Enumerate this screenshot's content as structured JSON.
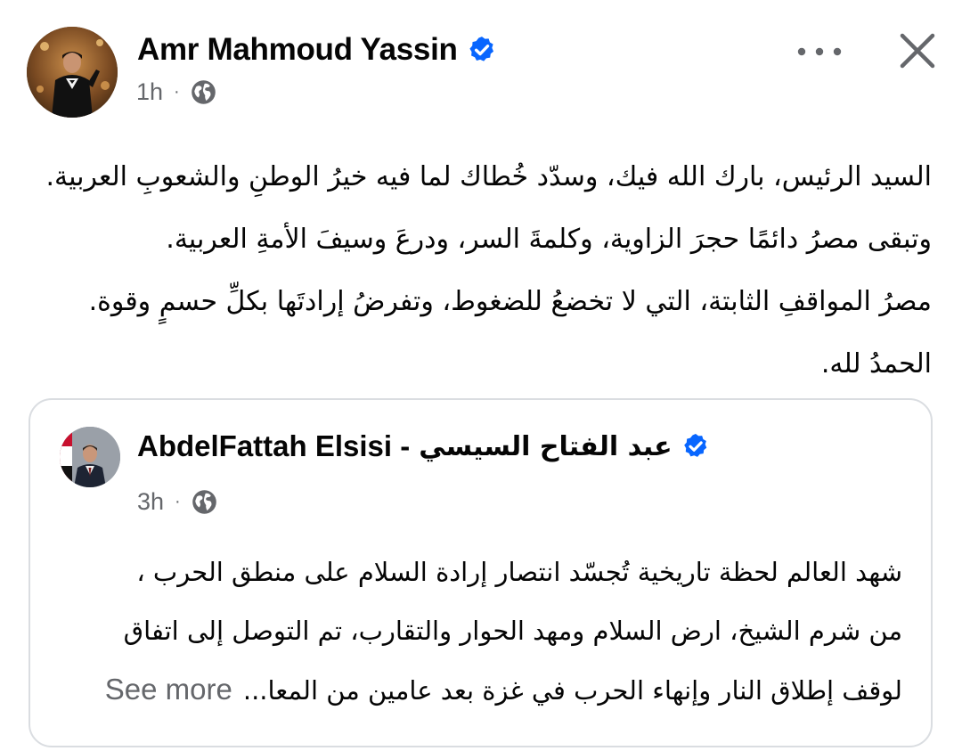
{
  "post": {
    "author": "Amr Mahmoud Yassin",
    "time": "1h",
    "dot": "·",
    "privacy_icon": "globe-icon",
    "verified_icon": "verified-badge-icon",
    "text_lines": [
      "السيد الرئيس، بارك الله فيك، وسدّد خُطاك لما فيه خيرُ الوطنِ والشعوبِ العربية.",
      "وتبقى مصرُ دائمًا حجرَ الزاوية، وكلمةَ السر، ودرعَ وسيفَ الأمةِ العربية.",
      "مصرُ المواقفِ الثابتة، التي لا تخضعُ للضغوط، وتفرضُ إرادتَها بكلِّ حسمٍ وقوة.",
      "الحمدُ لله."
    ]
  },
  "shared_post": {
    "author_en": "AbdelFattah Elsisi -",
    "author_ar": "عبد الفتاح السيسي",
    "time": "3h",
    "dot": "·",
    "privacy_icon": "globe-icon",
    "text_lines": [
      "شهد العالم لحظة تاريخية تُجسّد انتصار إرادة السلام على منطق الحرب ،",
      "من شرم الشيخ، ارض السلام ومهد الحوار والتقارب، تم التوصل إلى اتفاق",
      "لوقف إطلاق النار وإنهاء الحرب في غزة بعد عامين من المعا..."
    ],
    "see_more": "See more"
  },
  "colors": {
    "text": "#050505",
    "secondary": "#65676b",
    "verified": "#0866ff",
    "card_border": "#dadde1"
  }
}
